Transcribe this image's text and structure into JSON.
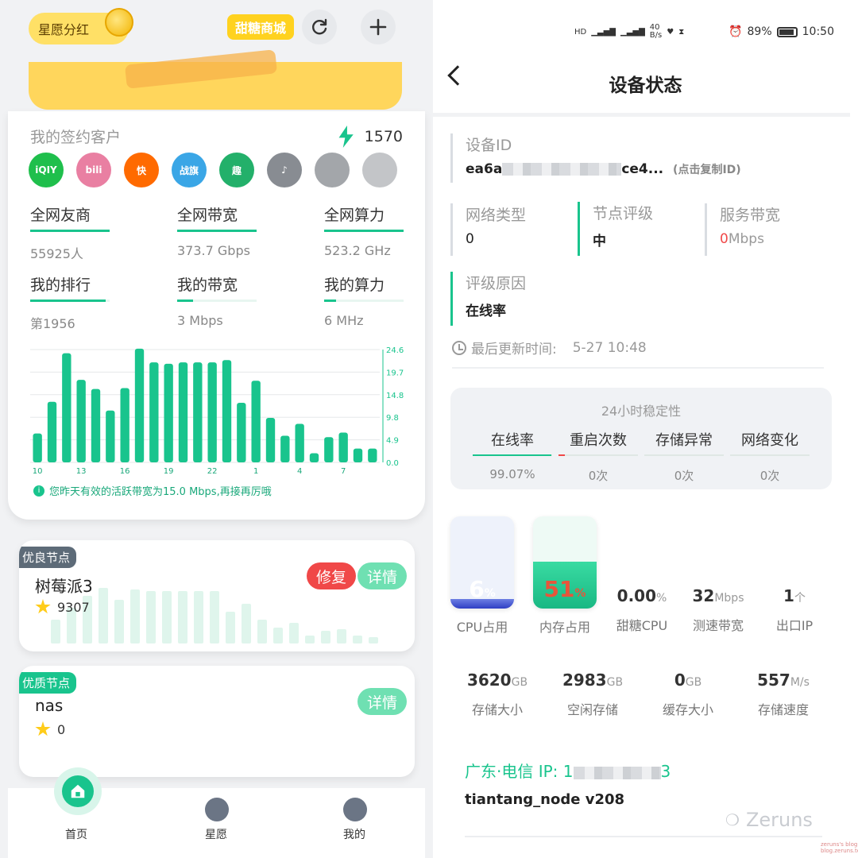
{
  "left": {
    "top": {
      "star_dividend": "星愿分红",
      "shop": "甜糖商城"
    },
    "signed": {
      "title": "我的签约客户",
      "count": "1570",
      "logos": [
        {
          "name": "iqiyi",
          "text": "iQIY",
          "color": "#1fbf4c"
        },
        {
          "name": "bilibili",
          "text": "bili",
          "color": "#e97fa2"
        },
        {
          "name": "kuaishou",
          "text": "快",
          "color": "#ff6a00"
        },
        {
          "name": "zhanqi",
          "text": "战旗",
          "color": "#3aa6e6"
        },
        {
          "name": "qu",
          "text": "趣",
          "color": "#23b06a"
        },
        {
          "name": "douyin",
          "text": "♪",
          "color": "#888c92"
        },
        {
          "name": "app7",
          "text": "",
          "color": "#a3a6aa"
        },
        {
          "name": "app8",
          "text": "",
          "color": "#c3c5c8"
        }
      ]
    },
    "stats": [
      {
        "label": "全网友商",
        "value": "55925人",
        "fill": 1.0
      },
      {
        "label": "全网带宽",
        "value": "373.7 Gbps",
        "fill": 1.0
      },
      {
        "label": "全网算力",
        "value": "523.2 GHz",
        "fill": 1.0
      },
      {
        "label": "我的排行",
        "value": "第1956",
        "fill": 0.95
      },
      {
        "label": "我的带宽",
        "value": "3 Mbps",
        "fill": 0.2
      },
      {
        "label": "我的算力",
        "value": "6 MHz",
        "fill": 0.15
      }
    ],
    "chart_note": "您昨天有效的活跃带宽为15.0 Mbps,再接再厉哦",
    "nodes": [
      {
        "tag": "优良节点",
        "tag_color": "#5d6b78",
        "name": "树莓派3",
        "score": "9307",
        "repair": "修复",
        "detail": "详情"
      },
      {
        "tag": "优质节点",
        "tag_color": "#19c48d",
        "name": "nas",
        "score": "0",
        "detail": "详情"
      }
    ],
    "nav": {
      "home": "首页",
      "star": "星愿",
      "mine": "我的"
    }
  },
  "chart_data": {
    "type": "bar",
    "categories": [
      "10",
      "11",
      "12",
      "13",
      "14",
      "15",
      "16",
      "17",
      "18",
      "19",
      "20",
      "21",
      "22",
      "23",
      "0",
      "1",
      "2",
      "3",
      "4",
      "5",
      "6",
      "7",
      "8",
      "9"
    ],
    "x_tick_labels": [
      "10",
      "13",
      "16",
      "19",
      "22",
      "1",
      "4",
      "7"
    ],
    "values": [
      6.3,
      13.2,
      23.8,
      18.0,
      16.0,
      11.3,
      16.2,
      24.8,
      21.8,
      21.5,
      21.8,
      21.8,
      21.8,
      22.3,
      13.0,
      17.8,
      9.7,
      5.8,
      8.4,
      2.0,
      5.5,
      6.5,
      3.0,
      3.0
    ],
    "y_ticks": [
      "24.6",
      "19.7",
      "14.8",
      "9.8",
      "4.9",
      "0.0"
    ],
    "ylim": [
      0,
      24.6
    ],
    "color": "#19c48d",
    "grid": true
  },
  "right": {
    "status": {
      "net_speed": "40\nB/s",
      "battery": "89%",
      "time": "10:50"
    },
    "title": "设备状态",
    "device_id_label": "设备ID",
    "device_id": "ea6a",
    "device_id_end": "ce4...",
    "copy_hint": "(点击复制ID)",
    "net_type_label": "网络类型",
    "net_type": "0",
    "rating_label": "节点评级",
    "rating": "中",
    "svc_bw_label": "服务带宽",
    "svc_bw_num": "0",
    "svc_bw_unit": "Mbps",
    "reason_label": "评级原因",
    "reason": "在线率",
    "update_label": "最后更新时间:",
    "update_time": "5-27 10:48",
    "stability": {
      "title": "24小时稳定性",
      "cols": [
        {
          "k": "在线率",
          "v": "99.07%",
          "color": "#19c48d",
          "fill": 0.99
        },
        {
          "k": "重启次数",
          "v": "0次",
          "color": "#f04848",
          "fill": 0.08
        },
        {
          "k": "存储异常",
          "v": "0次",
          "color": "#19c48d",
          "fill": 0
        },
        {
          "k": "网络变化",
          "v": "0次",
          "color": "#19c48d",
          "fill": 0
        }
      ]
    },
    "cpu": {
      "value": "6",
      "unit": "%",
      "label": "CPU占用",
      "fill": 0.06
    },
    "mem": {
      "value": "51",
      "unit": "%",
      "label": "内存占用",
      "fill": 0.51
    },
    "metrics_row1": [
      {
        "n": "0.00",
        "u": "%",
        "l": "甜糖CPU"
      },
      {
        "n": "32",
        "u": "Mbps",
        "l": "测速带宽"
      },
      {
        "n": "1",
        "u": "个",
        "l": "出口IP"
      }
    ],
    "metrics_row2": [
      {
        "n": "3620",
        "u": "GB",
        "l": "存储大小"
      },
      {
        "n": "2983",
        "u": "GB",
        "l": "空闲存储"
      },
      {
        "n": "0",
        "u": "GB",
        "l": "缓存大小"
      },
      {
        "n": "557",
        "u": "M/s",
        "l": "存储速度"
      }
    ],
    "location": "广东·电信 IP: 1",
    "location_end": "3",
    "version": "tiantang_node v208",
    "watermark": "Zeruns",
    "watermark_small": "zeruns's blog\nblog.zeruns.tech"
  }
}
